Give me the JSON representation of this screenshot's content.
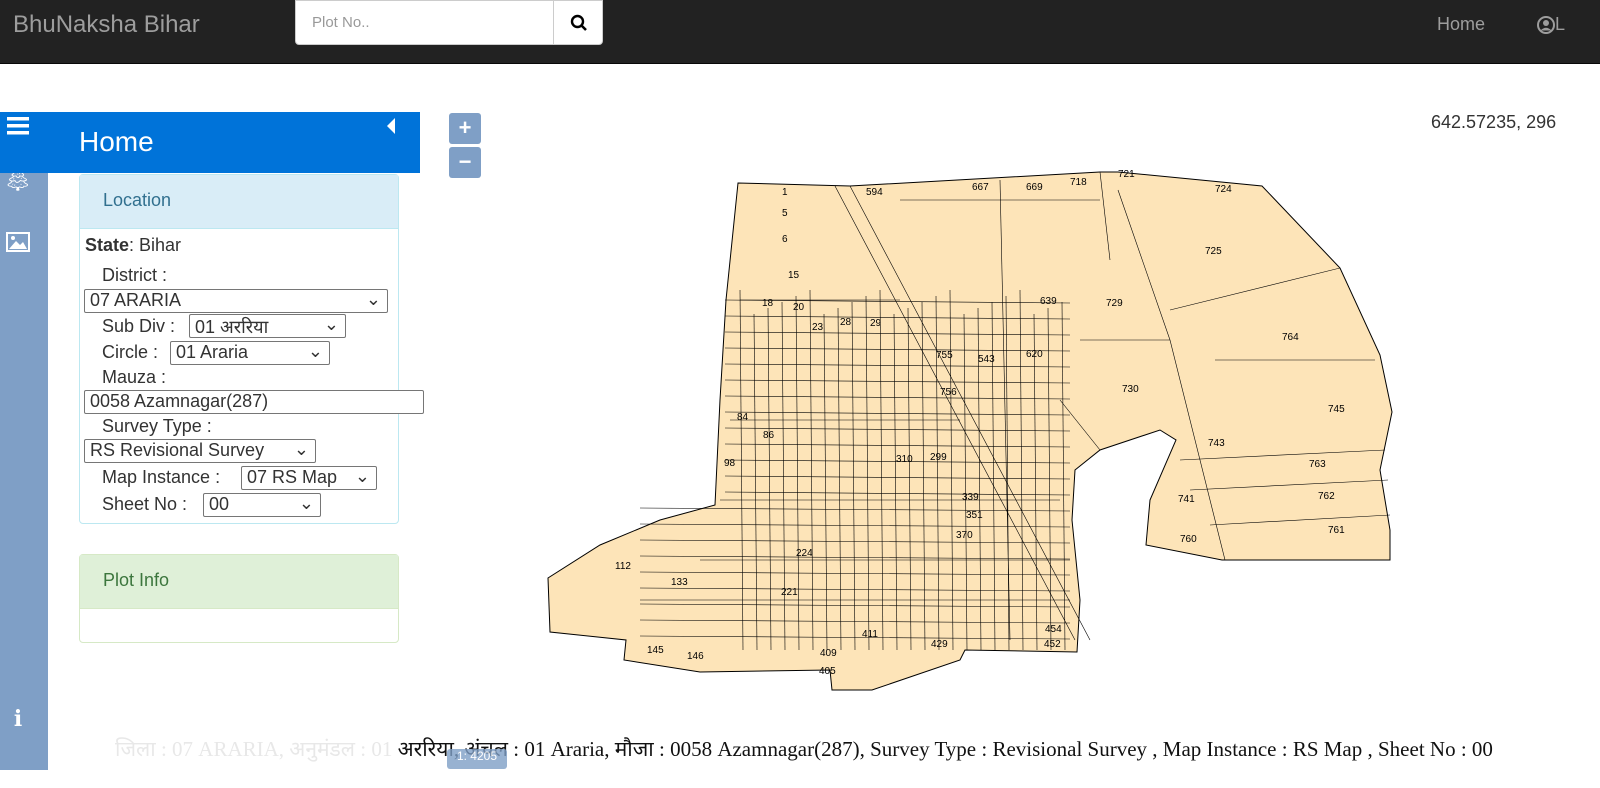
{
  "navbar": {
    "brand": "BhuNaksha Bihar",
    "search_placeholder": "Plot No..",
    "home_link": "Home",
    "login_link": "L"
  },
  "sidebar": {
    "title": "Home",
    "icons": [
      "menu-icon",
      "tree-icon",
      "image-icon",
      "info-icon"
    ]
  },
  "location": {
    "title": "Location",
    "state_label": "State",
    "state_value": ": Bihar",
    "district_label": "District :",
    "district_value": "07 ARARIA",
    "subdiv_label": "Sub Div :",
    "subdiv_value": "01 अररिया",
    "circle_label": "Circle :",
    "circle_value": "01 Araria",
    "mauza_label": "Mauza :",
    "mauza_value": "0058 Azamnagar(287)",
    "survey_label": "Survey Type :",
    "survey_value": "RS Revisional Survey",
    "map_instance_label": "Map Instance :",
    "map_instance_value": "07 RS Map",
    "sheet_label": "Sheet No :",
    "sheet_value": "00"
  },
  "plot_info": {
    "title": "Plot Info"
  },
  "map": {
    "zoom_in": "+",
    "zoom_out": "−",
    "coordinates": "642.57235, 296",
    "scale": "1: 4205",
    "fill_color": "#fde4b8",
    "plot_labels": [
      "1",
      "5",
      "6",
      "15",
      "594",
      "667",
      "669",
      "718",
      "721",
      "724",
      "725",
      "764",
      "745",
      "730",
      "743",
      "763",
      "762",
      "761",
      "760",
      "741",
      "729",
      "639",
      "620",
      "543",
      "755",
      "756",
      "339",
      "351",
      "370",
      "310",
      "299",
      "224",
      "221",
      "133",
      "112",
      "146",
      "145",
      "405",
      "409",
      "411",
      "429",
      "452",
      "454",
      "18",
      "20",
      "23",
      "28",
      "29",
      "84",
      "86",
      "98"
    ]
  },
  "footer": {
    "faded": "जिला : 07 ARARIA, अनुमंडल : 01 ",
    "text": "अररिया, अंचल : 01 Araria, मौजा : 0058 Azamnagar(287), Survey Type : Revisional Survey , Map Instance : RS Map , Sheet No : 00"
  }
}
